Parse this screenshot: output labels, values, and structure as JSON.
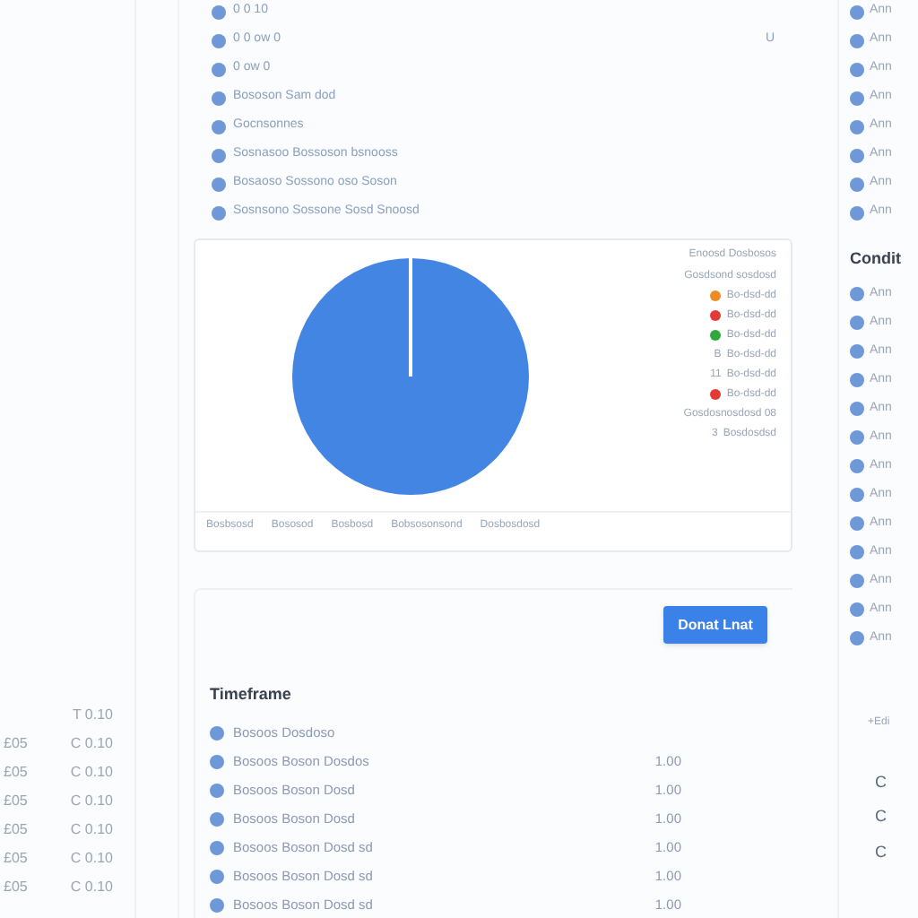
{
  "left_rows": [
    {
      "value": "T 0.10"
    },
    {
      "label": "£05",
      "value": "C 0.10"
    },
    {
      "label": "£05",
      "value": "C 0.10"
    },
    {
      "label": "£05",
      "value": "C 0.10"
    },
    {
      "label": "£05",
      "value": "C 0.10"
    },
    {
      "label": "£05",
      "value": "C 0.10"
    },
    {
      "label": "£05",
      "value": "C 0.10"
    }
  ],
  "top_list": [
    {
      "text": "0 0 10"
    },
    {
      "text": "0 0 ow 0",
      "side": "U"
    },
    {
      "text": "0 ow 0"
    },
    {
      "text": "Bososon Sam dod"
    },
    {
      "text": "Gocnsonnes"
    },
    {
      "text": "Sosnasoo Bossoson bsnooss"
    },
    {
      "text": "Bosaoso Sossono oso Soson"
    },
    {
      "text": "Sosnsono Sossone Sosd Snoosd"
    }
  ],
  "chart": {
    "legend_title": "Enoosd Dosbosos",
    "legend": [
      {
        "kind": "text",
        "text": "Gosdsond sosdosd"
      },
      {
        "kind": "dot",
        "color": "#f08a24",
        "text": "Bo-dsd-dd"
      },
      {
        "kind": "dot",
        "color": "#e53935",
        "text": "Bo-dsd-dd"
      },
      {
        "kind": "dot",
        "color": "#2eaa3a",
        "text": "Bo-dsd-dd"
      },
      {
        "kind": "mark",
        "mark": "B",
        "text": "Bo-dsd-dd"
      },
      {
        "kind": "mark",
        "mark": "11",
        "text": "Bo-dsd-dd"
      },
      {
        "kind": "dot",
        "color": "#e53935",
        "text": "Bo-dsd-dd"
      },
      {
        "kind": "text",
        "text": "Gosdosnosdosd 08"
      },
      {
        "kind": "mark",
        "mark": "3",
        "text": "Bosdosdsd"
      }
    ],
    "footer": [
      "Bosbsosd",
      "Bososod",
      "Bosbosd",
      "Bobsosonsond",
      "Dosbosdosd"
    ]
  },
  "button": "Donat Lnat",
  "timeframe": {
    "title": "Timeframe",
    "rows": [
      {
        "text": "Bosoos Dosdoso"
      },
      {
        "text": "Bosoos Boson Dosdos",
        "value": "1.00"
      },
      {
        "text": "Bosoos Boson Dosd",
        "value": "1.00"
      },
      {
        "text": "Bosoos Boson Dosd",
        "value": "1.00"
      },
      {
        "text": "Bosoos Boson Dosd sd",
        "value": "1.00"
      },
      {
        "text": "Bosoos Boson Dosd sd",
        "value": "1.00"
      },
      {
        "text": "Bosoos Boson Dosd sd",
        "value": "1.00"
      }
    ]
  },
  "right": {
    "top": [
      "Ann",
      "Ann",
      "Ann",
      "Ann",
      "Ann",
      "Ann",
      "Ann",
      "Ann"
    ],
    "title": "Condit",
    "items": [
      "Ann",
      "Ann",
      "Ann",
      "Ann",
      "Ann",
      "Ann",
      "Ann",
      "Ann",
      "Ann",
      "Ann",
      "Ann",
      "Ann",
      "Ann"
    ],
    "edit": "+Edi",
    "bottom": [
      "C",
      "C",
      "C"
    ]
  }
}
